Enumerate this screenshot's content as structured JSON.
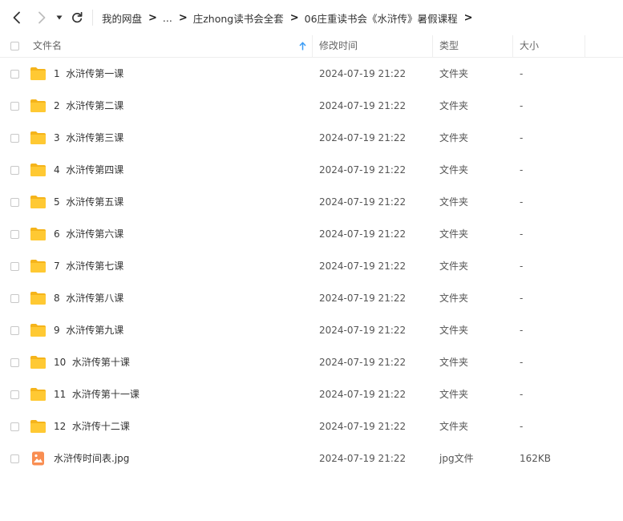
{
  "toolbar": {
    "back_icon": "chevron-left-icon",
    "forward_icon": "chevron-right-icon",
    "history_dropdown_icon": "caret-down-icon",
    "refresh_icon": "refresh-icon"
  },
  "breadcrumb": {
    "items": [
      "我的网盘",
      "...",
      "庄zhong读书会全套",
      "06庄重读书会《水浒传》暑假课程"
    ],
    "separator": ">"
  },
  "columns": {
    "name": "文件名",
    "modified": "修改时间",
    "type": "类型",
    "size": "大小",
    "sort_indicator": "arrow-up-icon"
  },
  "colors": {
    "folder_yellow": "#FFC933",
    "folder_back": "#F5B41B",
    "image_icon_orange": "#F98E52",
    "sort_arrow_blue": "#3B9CF5"
  },
  "files": [
    {
      "name": "1  水浒传第一课",
      "modified": "2024-07-19 21:22",
      "type": "文件夹",
      "size": "-",
      "icon": "folder-icon"
    },
    {
      "name": "2  水浒传第二课",
      "modified": "2024-07-19 21:22",
      "type": "文件夹",
      "size": "-",
      "icon": "folder-icon"
    },
    {
      "name": "3  水浒传第三课",
      "modified": "2024-07-19 21:22",
      "type": "文件夹",
      "size": "-",
      "icon": "folder-icon"
    },
    {
      "name": "4  水浒传第四课",
      "modified": "2024-07-19 21:22",
      "type": "文件夹",
      "size": "-",
      "icon": "folder-icon"
    },
    {
      "name": "5  水浒传第五课",
      "modified": "2024-07-19 21:22",
      "type": "文件夹",
      "size": "-",
      "icon": "folder-icon"
    },
    {
      "name": "6  水浒传第六课",
      "modified": "2024-07-19 21:22",
      "type": "文件夹",
      "size": "-",
      "icon": "folder-icon"
    },
    {
      "name": "7  水浒传第七课",
      "modified": "2024-07-19 21:22",
      "type": "文件夹",
      "size": "-",
      "icon": "folder-icon"
    },
    {
      "name": "8  水浒传第八课",
      "modified": "2024-07-19 21:22",
      "type": "文件夹",
      "size": "-",
      "icon": "folder-icon"
    },
    {
      "name": "9  水浒传第九课",
      "modified": "2024-07-19 21:22",
      "type": "文件夹",
      "size": "-",
      "icon": "folder-icon"
    },
    {
      "name": "10  水浒传第十课",
      "modified": "2024-07-19 21:22",
      "type": "文件夹",
      "size": "-",
      "icon": "folder-icon"
    },
    {
      "name": "11  水浒传第十一课",
      "modified": "2024-07-19 21:22",
      "type": "文件夹",
      "size": "-",
      "icon": "folder-icon"
    },
    {
      "name": "12  水浒传十二课",
      "modified": "2024-07-19 21:22",
      "type": "文件夹",
      "size": "-",
      "icon": "folder-icon"
    },
    {
      "name": "水浒传时间表.jpg",
      "modified": "2024-07-19 21:22",
      "type": "jpg文件",
      "size": "162KB",
      "icon": "image-file-icon"
    }
  ]
}
